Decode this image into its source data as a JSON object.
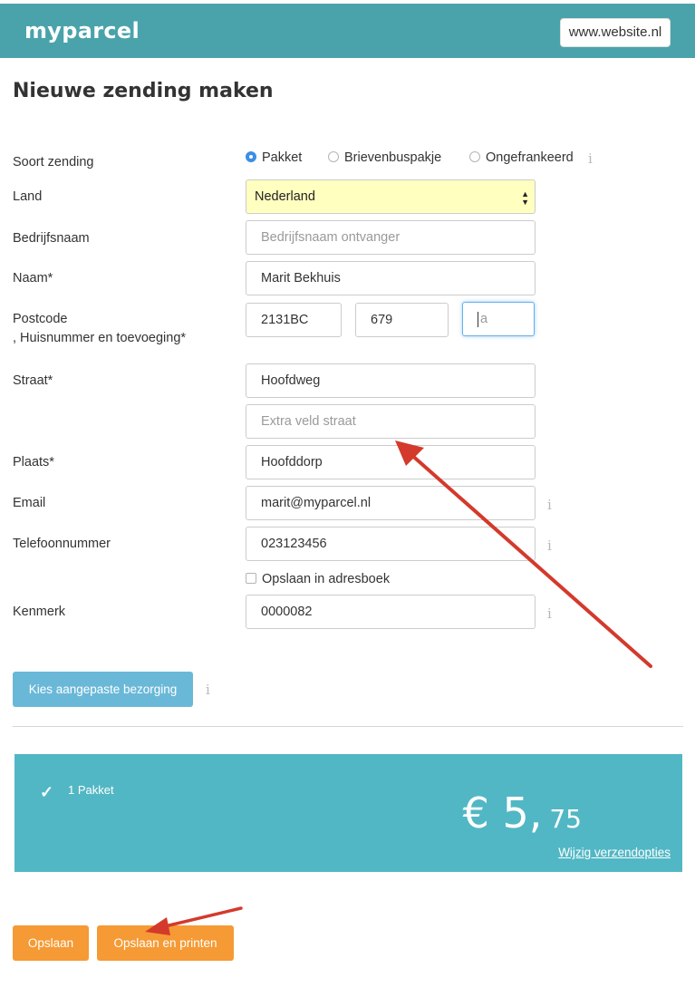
{
  "header": {
    "logo": "myparcel",
    "site_link": "www.website.nl",
    "bar_color": "#4aa3ab"
  },
  "page_title": "Nieuwe zending maken",
  "form": {
    "shipment_type": {
      "label": "Soort zending",
      "options": [
        "Pakket",
        "Brievenbuspakje",
        "Ongefrankeerd"
      ],
      "selected": "Pakket",
      "info_icon": "info-icon"
    },
    "country": {
      "label": "Land",
      "value": "Nederland"
    },
    "company": {
      "label": "Bedrijfsnaam",
      "placeholder": "Bedrijfsnaam ontvanger"
    },
    "name": {
      "label": "Naam*",
      "value": "Marit Bekhuis"
    },
    "postcode": {
      "label_line1": "Postcode",
      "label_line2": ", Huisnummer en toevoeging*",
      "postcode_value": "2131BC",
      "house_number_value": "679",
      "addition_placeholder": "a"
    },
    "street": {
      "label": "Straat*",
      "value": "Hoofdweg",
      "extra_placeholder": "Extra veld straat"
    },
    "city": {
      "label": "Plaats*",
      "value": "Hoofddorp"
    },
    "email": {
      "label": "Email",
      "value": "marit@myparcel.nl"
    },
    "phone": {
      "label": "Telefoonnummer",
      "value": "023123456"
    },
    "save_address": {
      "label": "Opslaan in adresboek",
      "checked": false
    },
    "reference": {
      "label": "Kenmerk",
      "value": "0000082"
    },
    "info_glyph": "i"
  },
  "custom_delivery_button": "Kies aangepaste bezorging",
  "summary": {
    "background": "#52b7c4",
    "item": "1 Pakket",
    "check_icon": "checkmark-icon",
    "price_main": "€ 5,",
    "price_cents": "75",
    "change_link": "Wijzig verzendopties"
  },
  "actions": {
    "save": "Opslaan",
    "save_print": "Opslaan en printen",
    "button_color": "#f59a34"
  },
  "annotations": {
    "arrow_color": "#d33a2c"
  }
}
